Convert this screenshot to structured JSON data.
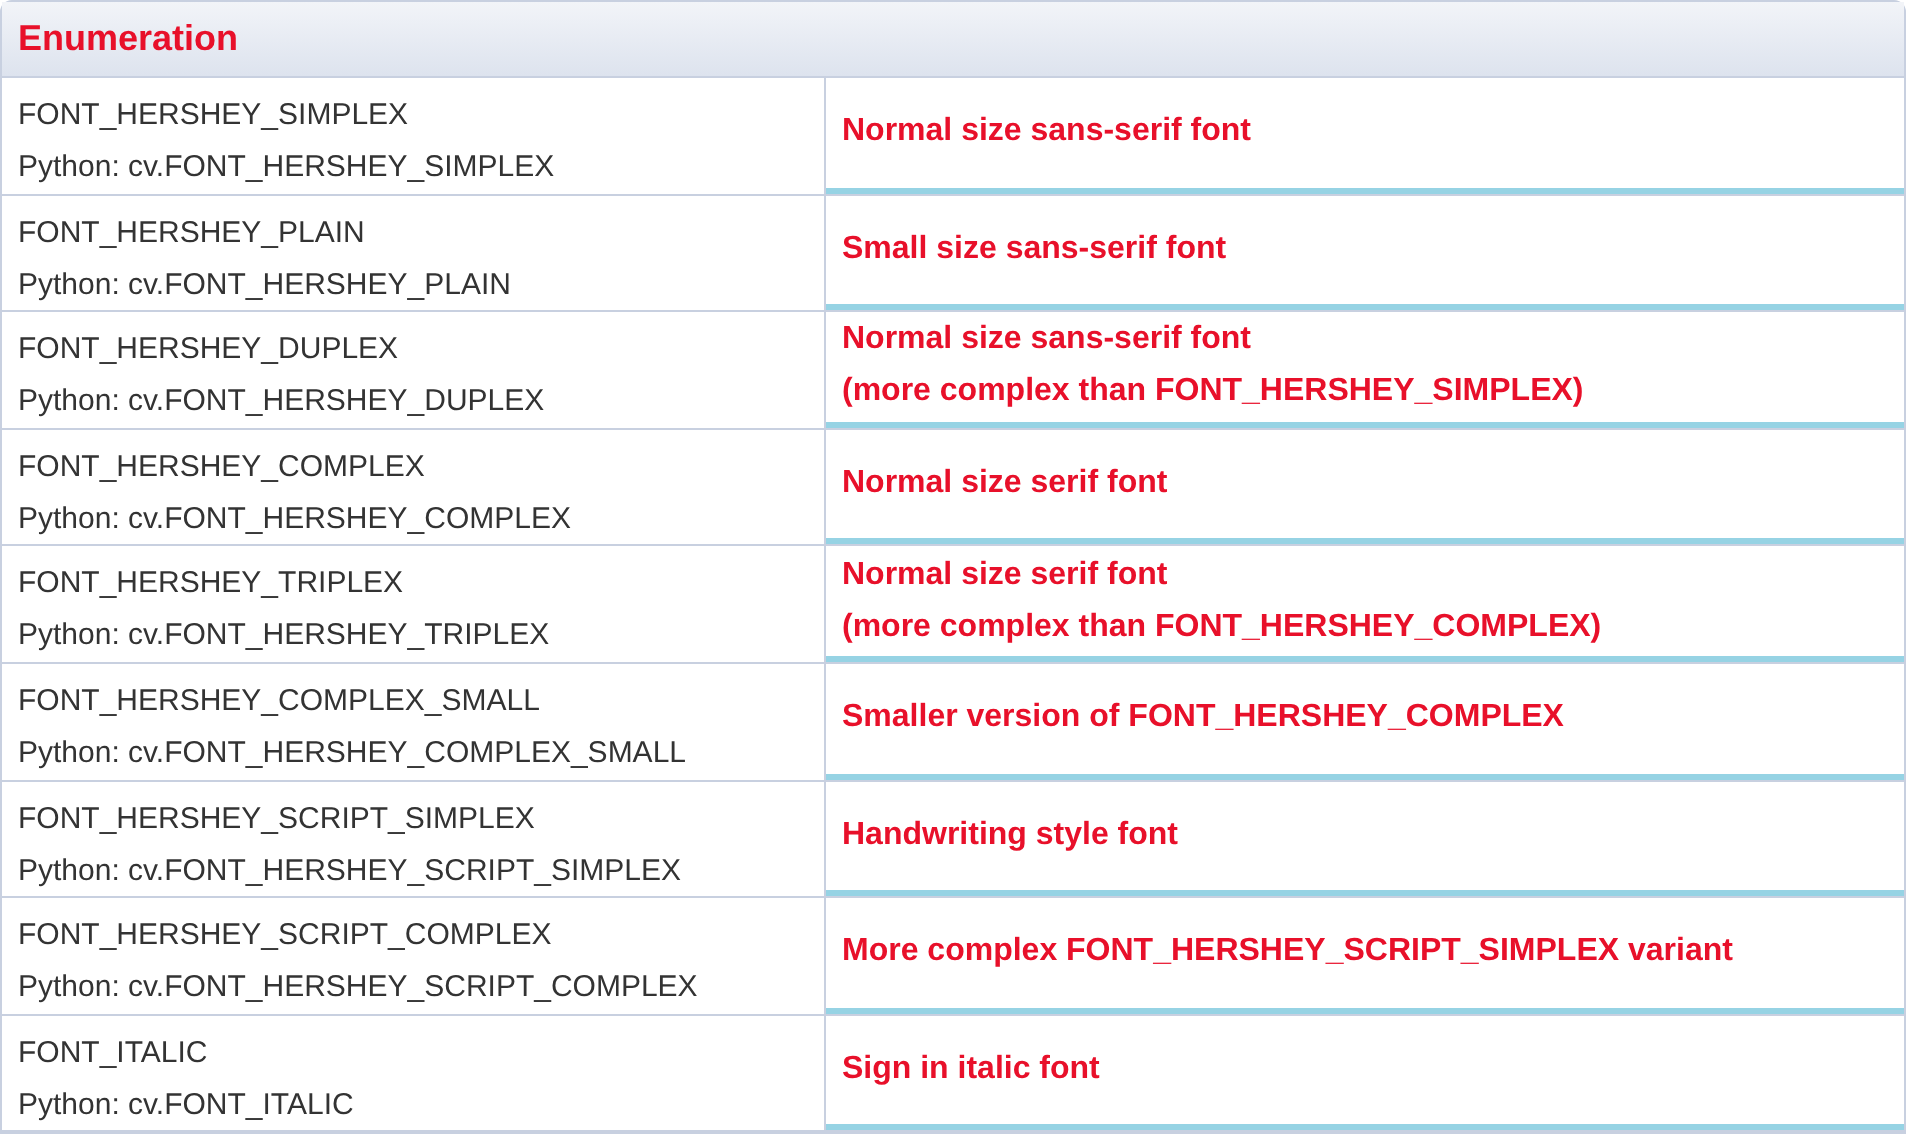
{
  "table": {
    "header": "Enumeration",
    "rows": [
      {
        "name": "FONT_HERSHEY_SIMPLEX",
        "python": "Python: cv.FONT_HERSHEY_SIMPLEX",
        "description": [
          "Normal size sans-serif font"
        ]
      },
      {
        "name": "FONT_HERSHEY_PLAIN",
        "python": "Python: cv.FONT_HERSHEY_PLAIN",
        "description": [
          "Small size sans-serif font"
        ]
      },
      {
        "name": "FONT_HERSHEY_DUPLEX",
        "python": "Python: cv.FONT_HERSHEY_DUPLEX",
        "description": [
          "Normal size sans-serif font",
          "(more complex than FONT_HERSHEY_SIMPLEX)"
        ]
      },
      {
        "name": "FONT_HERSHEY_COMPLEX",
        "python": "Python: cv.FONT_HERSHEY_COMPLEX",
        "description": [
          "Normal size serif font"
        ]
      },
      {
        "name": "FONT_HERSHEY_TRIPLEX",
        "python": "Python: cv.FONT_HERSHEY_TRIPLEX",
        "description": [
          "Normal size serif font",
          "(more complex than FONT_HERSHEY_COMPLEX)"
        ]
      },
      {
        "name": "FONT_HERSHEY_COMPLEX_SMALL",
        "python": "Python: cv.FONT_HERSHEY_COMPLEX_SMALL",
        "description": [
          "Smaller version of FONT_HERSHEY_COMPLEX"
        ]
      },
      {
        "name": "FONT_HERSHEY_SCRIPT_SIMPLEX",
        "python": "Python: cv.FONT_HERSHEY_SCRIPT_SIMPLEX",
        "description": [
          "Handwriting style font"
        ]
      },
      {
        "name": "FONT_HERSHEY_SCRIPT_COMPLEX",
        "python": "Python: cv.FONT_HERSHEY_SCRIPT_COMPLEX",
        "description": [
          "More complex FONT_HERSHEY_SCRIPT_SIMPLEX variant"
        ]
      },
      {
        "name": "FONT_ITALIC",
        "python": "Python: cv.FONT_ITALIC",
        "description": [
          "Sign in italic font"
        ]
      }
    ]
  }
}
